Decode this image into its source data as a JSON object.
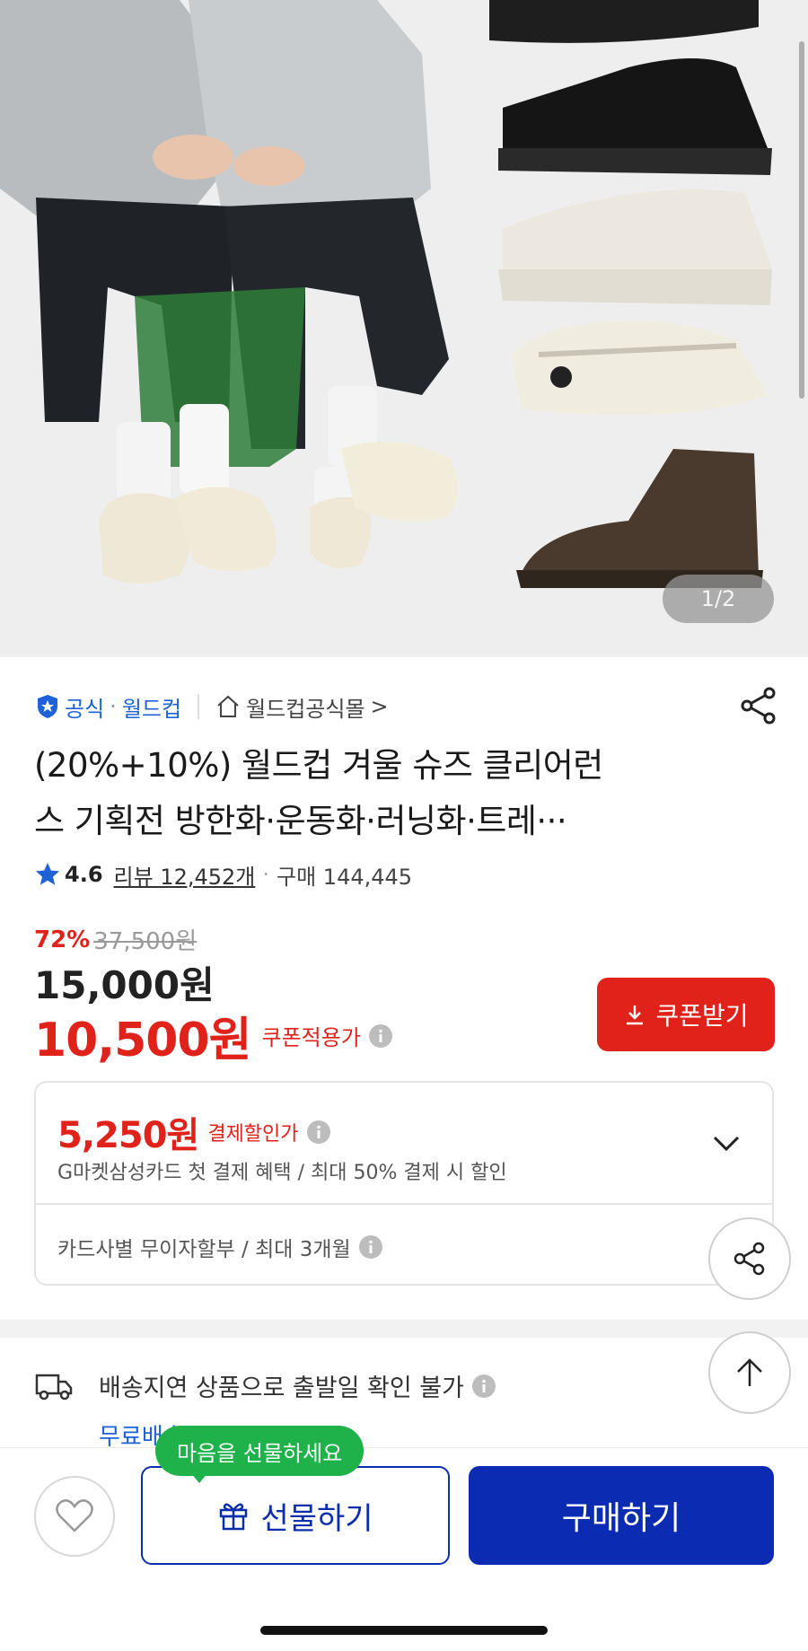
{
  "hero": {
    "page_counter": "1/2"
  },
  "seller": {
    "badge_label": "공식",
    "separator": "·",
    "brand": "월드컵",
    "store_name": "월드컵공식몰",
    "store_chevron": ">"
  },
  "product": {
    "title_line1": "(20%+10%) 월드컵 겨울 슈즈 클리어런",
    "title_line2": "스 기획전  방한화·운동화·러닝화·트레···"
  },
  "rating": {
    "score": "4.6",
    "review_text": "리뷰 12,452개",
    "separator": "·",
    "purchase_text": "구매 144,445"
  },
  "price": {
    "discount_rate": "72%",
    "original_price": "37,500원",
    "sale_price": "15,000원",
    "coupon_price": "10,500원",
    "coupon_label": "쿠폰적용가",
    "coupon_button": "쿠폰받기"
  },
  "payment": {
    "price": "5,250원",
    "label": "결제할인가",
    "description": "G마켓삼성카드 첫 결제 혜택 / 최대 50% 결제 시 할인",
    "installment": "카드사별 무이자할부 / 최대 3개월"
  },
  "shipping": {
    "notice": "배송지연 상품으로 출발일 확인 불가",
    "free_label": "무료배송"
  },
  "bottom": {
    "tooltip": "마음을 선물하세요",
    "gift_label": "선물하기",
    "buy_label": "구매하기"
  },
  "colors": {
    "accent_red": "#e0221b",
    "brand_blue": "#0b2bb2",
    "link_blue": "#1d62d6",
    "tooltip_green": "#1fb14a"
  },
  "icons": [
    "shield-star-icon",
    "home-icon",
    "share-icon",
    "star-icon",
    "info-icon",
    "download-icon",
    "chevron-down-icon",
    "truck-icon",
    "arrow-up-icon",
    "heart-icon",
    "gift-icon"
  ]
}
